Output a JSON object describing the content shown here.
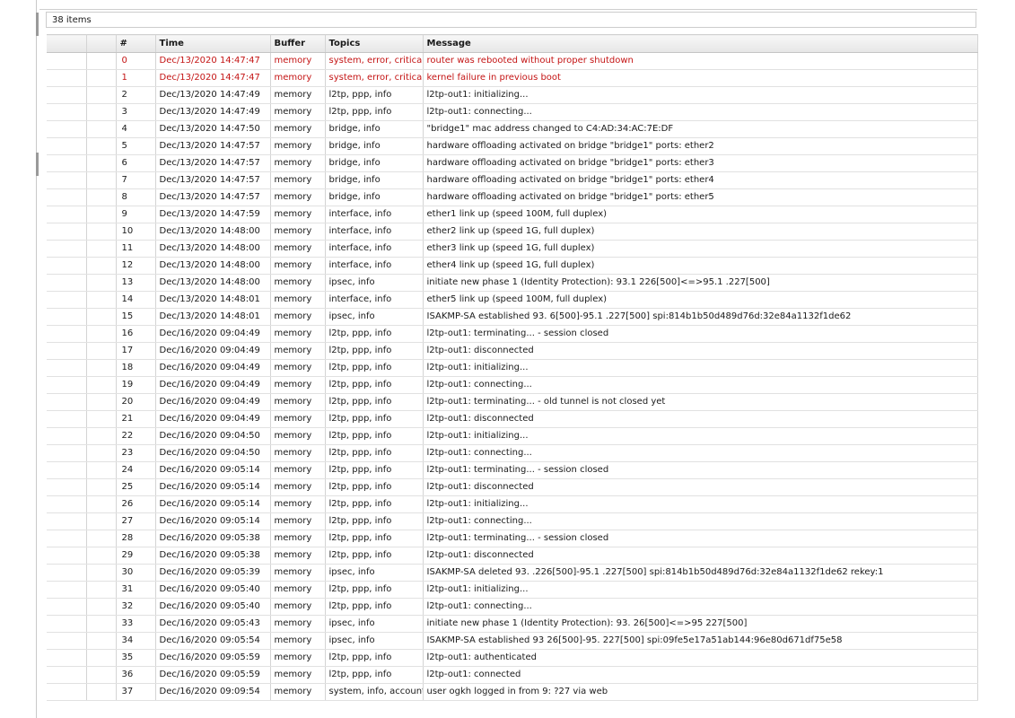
{
  "status": {
    "items_count": "38 items"
  },
  "table": {
    "columns": [
      "#",
      "Time",
      "Buffer",
      "Topics",
      "Message"
    ],
    "rows": [
      {
        "n": "0",
        "time": "Dec/13/2020 14:47:47",
        "buffer": "memory",
        "topics": "system, error, critical",
        "message": "router was rebooted without proper shutdown",
        "critical": true
      },
      {
        "n": "1",
        "time": "Dec/13/2020 14:47:47",
        "buffer": "memory",
        "topics": "system, error, critical",
        "message": "kernel failure in previous boot",
        "critical": true
      },
      {
        "n": "2",
        "time": "Dec/13/2020 14:47:49",
        "buffer": "memory",
        "topics": "l2tp, ppp, info",
        "message": "l2tp-out1: initializing..."
      },
      {
        "n": "3",
        "time": "Dec/13/2020 14:47:49",
        "buffer": "memory",
        "topics": "l2tp, ppp, info",
        "message": "l2tp-out1: connecting..."
      },
      {
        "n": "4",
        "time": "Dec/13/2020 14:47:50",
        "buffer": "memory",
        "topics": "bridge, info",
        "message": "\"bridge1\" mac address changed to C4:AD:34:AC:7E:DF"
      },
      {
        "n": "5",
        "time": "Dec/13/2020 14:47:57",
        "buffer": "memory",
        "topics": "bridge, info",
        "message": "hardware offloading activated on bridge \"bridge1\" ports: ether2"
      },
      {
        "n": "6",
        "time": "Dec/13/2020 14:47:57",
        "buffer": "memory",
        "topics": "bridge, info",
        "message": "hardware offloading activated on bridge \"bridge1\" ports: ether3"
      },
      {
        "n": "7",
        "time": "Dec/13/2020 14:47:57",
        "buffer": "memory",
        "topics": "bridge, info",
        "message": "hardware offloading activated on bridge \"bridge1\" ports: ether4"
      },
      {
        "n": "8",
        "time": "Dec/13/2020 14:47:57",
        "buffer": "memory",
        "topics": "bridge, info",
        "message": "hardware offloading activated on bridge \"bridge1\" ports: ether5"
      },
      {
        "n": "9",
        "time": "Dec/13/2020 14:47:59",
        "buffer": "memory",
        "topics": "interface, info",
        "message": "ether1 link up (speed 100M, full duplex)"
      },
      {
        "n": "10",
        "time": "Dec/13/2020 14:48:00",
        "buffer": "memory",
        "topics": "interface, info",
        "message": "ether2 link up (speed 1G, full duplex)"
      },
      {
        "n": "11",
        "time": "Dec/13/2020 14:48:00",
        "buffer": "memory",
        "topics": "interface, info",
        "message": "ether3 link up (speed 1G, full duplex)"
      },
      {
        "n": "12",
        "time": "Dec/13/2020 14:48:00",
        "buffer": "memory",
        "topics": "interface, info",
        "message": "ether4 link up (speed 1G, full duplex)"
      },
      {
        "n": "13",
        "time": "Dec/13/2020 14:48:00",
        "buffer": "memory",
        "topics": "ipsec, info",
        "message": "initiate new phase 1 (Identity Protection): 93.1            226[500]<=>95.1            .227[500]"
      },
      {
        "n": "14",
        "time": "Dec/13/2020 14:48:01",
        "buffer": "memory",
        "topics": "interface, info",
        "message": "ether5 link up (speed 100M, full duplex)"
      },
      {
        "n": "15",
        "time": "Dec/13/2020 14:48:01",
        "buffer": "memory",
        "topics": "ipsec, info",
        "message": "ISAKMP-SA established 93.            6[500]-95.1        .227[500] spi:814b1b50d489d76d:32e84a1132f1de62"
      },
      {
        "n": "16",
        "time": "Dec/16/2020 09:04:49",
        "buffer": "memory",
        "topics": "l2tp, ppp, info",
        "message": "l2tp-out1: terminating... - session closed"
      },
      {
        "n": "17",
        "time": "Dec/16/2020 09:04:49",
        "buffer": "memory",
        "topics": "l2tp, ppp, info",
        "message": "l2tp-out1: disconnected"
      },
      {
        "n": "18",
        "time": "Dec/16/2020 09:04:49",
        "buffer": "memory",
        "topics": "l2tp, ppp, info",
        "message": "l2tp-out1: initializing..."
      },
      {
        "n": "19",
        "time": "Dec/16/2020 09:04:49",
        "buffer": "memory",
        "topics": "l2tp, ppp, info",
        "message": "l2tp-out1: connecting..."
      },
      {
        "n": "20",
        "time": "Dec/16/2020 09:04:49",
        "buffer": "memory",
        "topics": "l2tp, ppp, info",
        "message": "l2tp-out1: terminating... - old tunnel is not closed yet"
      },
      {
        "n": "21",
        "time": "Dec/16/2020 09:04:49",
        "buffer": "memory",
        "topics": "l2tp, ppp, info",
        "message": "l2tp-out1: disconnected"
      },
      {
        "n": "22",
        "time": "Dec/16/2020 09:04:50",
        "buffer": "memory",
        "topics": "l2tp, ppp, info",
        "message": "l2tp-out1: initializing..."
      },
      {
        "n": "23",
        "time": "Dec/16/2020 09:04:50",
        "buffer": "memory",
        "topics": "l2tp, ppp, info",
        "message": "l2tp-out1: connecting..."
      },
      {
        "n": "24",
        "time": "Dec/16/2020 09:05:14",
        "buffer": "memory",
        "topics": "l2tp, ppp, info",
        "message": "l2tp-out1: terminating... - session closed"
      },
      {
        "n": "25",
        "time": "Dec/16/2020 09:05:14",
        "buffer": "memory",
        "topics": "l2tp, ppp, info",
        "message": "l2tp-out1: disconnected"
      },
      {
        "n": "26",
        "time": "Dec/16/2020 09:05:14",
        "buffer": "memory",
        "topics": "l2tp, ppp, info",
        "message": "l2tp-out1: initializing..."
      },
      {
        "n": "27",
        "time": "Dec/16/2020 09:05:14",
        "buffer": "memory",
        "topics": "l2tp, ppp, info",
        "message": "l2tp-out1: connecting..."
      },
      {
        "n": "28",
        "time": "Dec/16/2020 09:05:38",
        "buffer": "memory",
        "topics": "l2tp, ppp, info",
        "message": "l2tp-out1: terminating... - session closed"
      },
      {
        "n": "29",
        "time": "Dec/16/2020 09:05:38",
        "buffer": "memory",
        "topics": "l2tp, ppp, info",
        "message": "l2tp-out1: disconnected"
      },
      {
        "n": "30",
        "time": "Dec/16/2020 09:05:39",
        "buffer": "memory",
        "topics": "ipsec, info",
        "message": "ISAKMP-SA deleted 93.            .226[500]-95.1          .227[500] spi:814b1b50d489d76d:32e84a1132f1de62 rekey:1"
      },
      {
        "n": "31",
        "time": "Dec/16/2020 09:05:40",
        "buffer": "memory",
        "topics": "l2tp, ppp, info",
        "message": "l2tp-out1: initializing..."
      },
      {
        "n": "32",
        "time": "Dec/16/2020 09:05:40",
        "buffer": "memory",
        "topics": "l2tp, ppp, info",
        "message": "l2tp-out1: connecting..."
      },
      {
        "n": "33",
        "time": "Dec/16/2020 09:05:43",
        "buffer": "memory",
        "topics": "ipsec, info",
        "message": "initiate new phase 1 (Identity Protection): 93.            26[500]<=>95            227[500]"
      },
      {
        "n": "34",
        "time": "Dec/16/2020 09:05:54",
        "buffer": "memory",
        "topics": "ipsec, info",
        "message": "ISAKMP-SA established 93            26[500]-95.         227[500] spi:09fe5e17a51ab144:96e80d671df75e58"
      },
      {
        "n": "35",
        "time": "Dec/16/2020 09:05:59",
        "buffer": "memory",
        "topics": "l2tp, ppp, info",
        "message": "l2tp-out1: authenticated"
      },
      {
        "n": "36",
        "time": "Dec/16/2020 09:05:59",
        "buffer": "memory",
        "topics": "l2tp, ppp, info",
        "message": "l2tp-out1: connected"
      },
      {
        "n": "37",
        "time": "Dec/16/2020 09:09:54",
        "buffer": "memory",
        "topics": "system, info, account",
        "message": "user ogkh logged in from 9:            ?27 via web"
      }
    ]
  },
  "colors": {
    "critical_text": "#c41414",
    "normal_text": "#1a1a1a"
  }
}
